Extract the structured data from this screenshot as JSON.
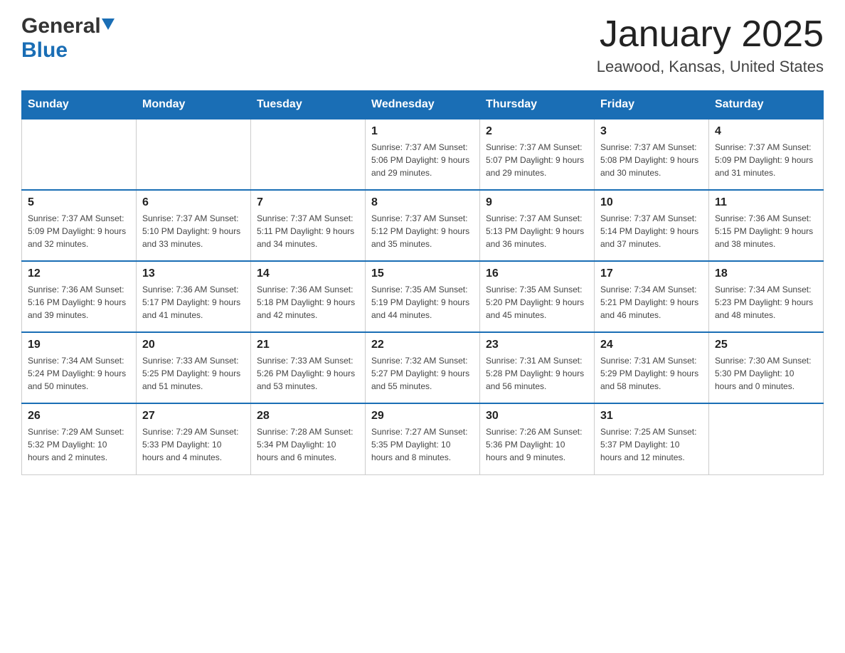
{
  "header": {
    "logo_general": "General",
    "logo_blue": "Blue",
    "title": "January 2025",
    "subtitle": "Leawood, Kansas, United States"
  },
  "days_of_week": [
    "Sunday",
    "Monday",
    "Tuesday",
    "Wednesday",
    "Thursday",
    "Friday",
    "Saturday"
  ],
  "weeks": [
    [
      {
        "day": "",
        "info": ""
      },
      {
        "day": "",
        "info": ""
      },
      {
        "day": "",
        "info": ""
      },
      {
        "day": "1",
        "info": "Sunrise: 7:37 AM\nSunset: 5:06 PM\nDaylight: 9 hours and 29 minutes."
      },
      {
        "day": "2",
        "info": "Sunrise: 7:37 AM\nSunset: 5:07 PM\nDaylight: 9 hours and 29 minutes."
      },
      {
        "day": "3",
        "info": "Sunrise: 7:37 AM\nSunset: 5:08 PM\nDaylight: 9 hours and 30 minutes."
      },
      {
        "day": "4",
        "info": "Sunrise: 7:37 AM\nSunset: 5:09 PM\nDaylight: 9 hours and 31 minutes."
      }
    ],
    [
      {
        "day": "5",
        "info": "Sunrise: 7:37 AM\nSunset: 5:09 PM\nDaylight: 9 hours and 32 minutes."
      },
      {
        "day": "6",
        "info": "Sunrise: 7:37 AM\nSunset: 5:10 PM\nDaylight: 9 hours and 33 minutes."
      },
      {
        "day": "7",
        "info": "Sunrise: 7:37 AM\nSunset: 5:11 PM\nDaylight: 9 hours and 34 minutes."
      },
      {
        "day": "8",
        "info": "Sunrise: 7:37 AM\nSunset: 5:12 PM\nDaylight: 9 hours and 35 minutes."
      },
      {
        "day": "9",
        "info": "Sunrise: 7:37 AM\nSunset: 5:13 PM\nDaylight: 9 hours and 36 minutes."
      },
      {
        "day": "10",
        "info": "Sunrise: 7:37 AM\nSunset: 5:14 PM\nDaylight: 9 hours and 37 minutes."
      },
      {
        "day": "11",
        "info": "Sunrise: 7:36 AM\nSunset: 5:15 PM\nDaylight: 9 hours and 38 minutes."
      }
    ],
    [
      {
        "day": "12",
        "info": "Sunrise: 7:36 AM\nSunset: 5:16 PM\nDaylight: 9 hours and 39 minutes."
      },
      {
        "day": "13",
        "info": "Sunrise: 7:36 AM\nSunset: 5:17 PM\nDaylight: 9 hours and 41 minutes."
      },
      {
        "day": "14",
        "info": "Sunrise: 7:36 AM\nSunset: 5:18 PM\nDaylight: 9 hours and 42 minutes."
      },
      {
        "day": "15",
        "info": "Sunrise: 7:35 AM\nSunset: 5:19 PM\nDaylight: 9 hours and 44 minutes."
      },
      {
        "day": "16",
        "info": "Sunrise: 7:35 AM\nSunset: 5:20 PM\nDaylight: 9 hours and 45 minutes."
      },
      {
        "day": "17",
        "info": "Sunrise: 7:34 AM\nSunset: 5:21 PM\nDaylight: 9 hours and 46 minutes."
      },
      {
        "day": "18",
        "info": "Sunrise: 7:34 AM\nSunset: 5:23 PM\nDaylight: 9 hours and 48 minutes."
      }
    ],
    [
      {
        "day": "19",
        "info": "Sunrise: 7:34 AM\nSunset: 5:24 PM\nDaylight: 9 hours and 50 minutes."
      },
      {
        "day": "20",
        "info": "Sunrise: 7:33 AM\nSunset: 5:25 PM\nDaylight: 9 hours and 51 minutes."
      },
      {
        "day": "21",
        "info": "Sunrise: 7:33 AM\nSunset: 5:26 PM\nDaylight: 9 hours and 53 minutes."
      },
      {
        "day": "22",
        "info": "Sunrise: 7:32 AM\nSunset: 5:27 PM\nDaylight: 9 hours and 55 minutes."
      },
      {
        "day": "23",
        "info": "Sunrise: 7:31 AM\nSunset: 5:28 PM\nDaylight: 9 hours and 56 minutes."
      },
      {
        "day": "24",
        "info": "Sunrise: 7:31 AM\nSunset: 5:29 PM\nDaylight: 9 hours and 58 minutes."
      },
      {
        "day": "25",
        "info": "Sunrise: 7:30 AM\nSunset: 5:30 PM\nDaylight: 10 hours and 0 minutes."
      }
    ],
    [
      {
        "day": "26",
        "info": "Sunrise: 7:29 AM\nSunset: 5:32 PM\nDaylight: 10 hours and 2 minutes."
      },
      {
        "day": "27",
        "info": "Sunrise: 7:29 AM\nSunset: 5:33 PM\nDaylight: 10 hours and 4 minutes."
      },
      {
        "day": "28",
        "info": "Sunrise: 7:28 AM\nSunset: 5:34 PM\nDaylight: 10 hours and 6 minutes."
      },
      {
        "day": "29",
        "info": "Sunrise: 7:27 AM\nSunset: 5:35 PM\nDaylight: 10 hours and 8 minutes."
      },
      {
        "day": "30",
        "info": "Sunrise: 7:26 AM\nSunset: 5:36 PM\nDaylight: 10 hours and 9 minutes."
      },
      {
        "day": "31",
        "info": "Sunrise: 7:25 AM\nSunset: 5:37 PM\nDaylight: 10 hours and 12 minutes."
      },
      {
        "day": "",
        "info": ""
      }
    ]
  ]
}
